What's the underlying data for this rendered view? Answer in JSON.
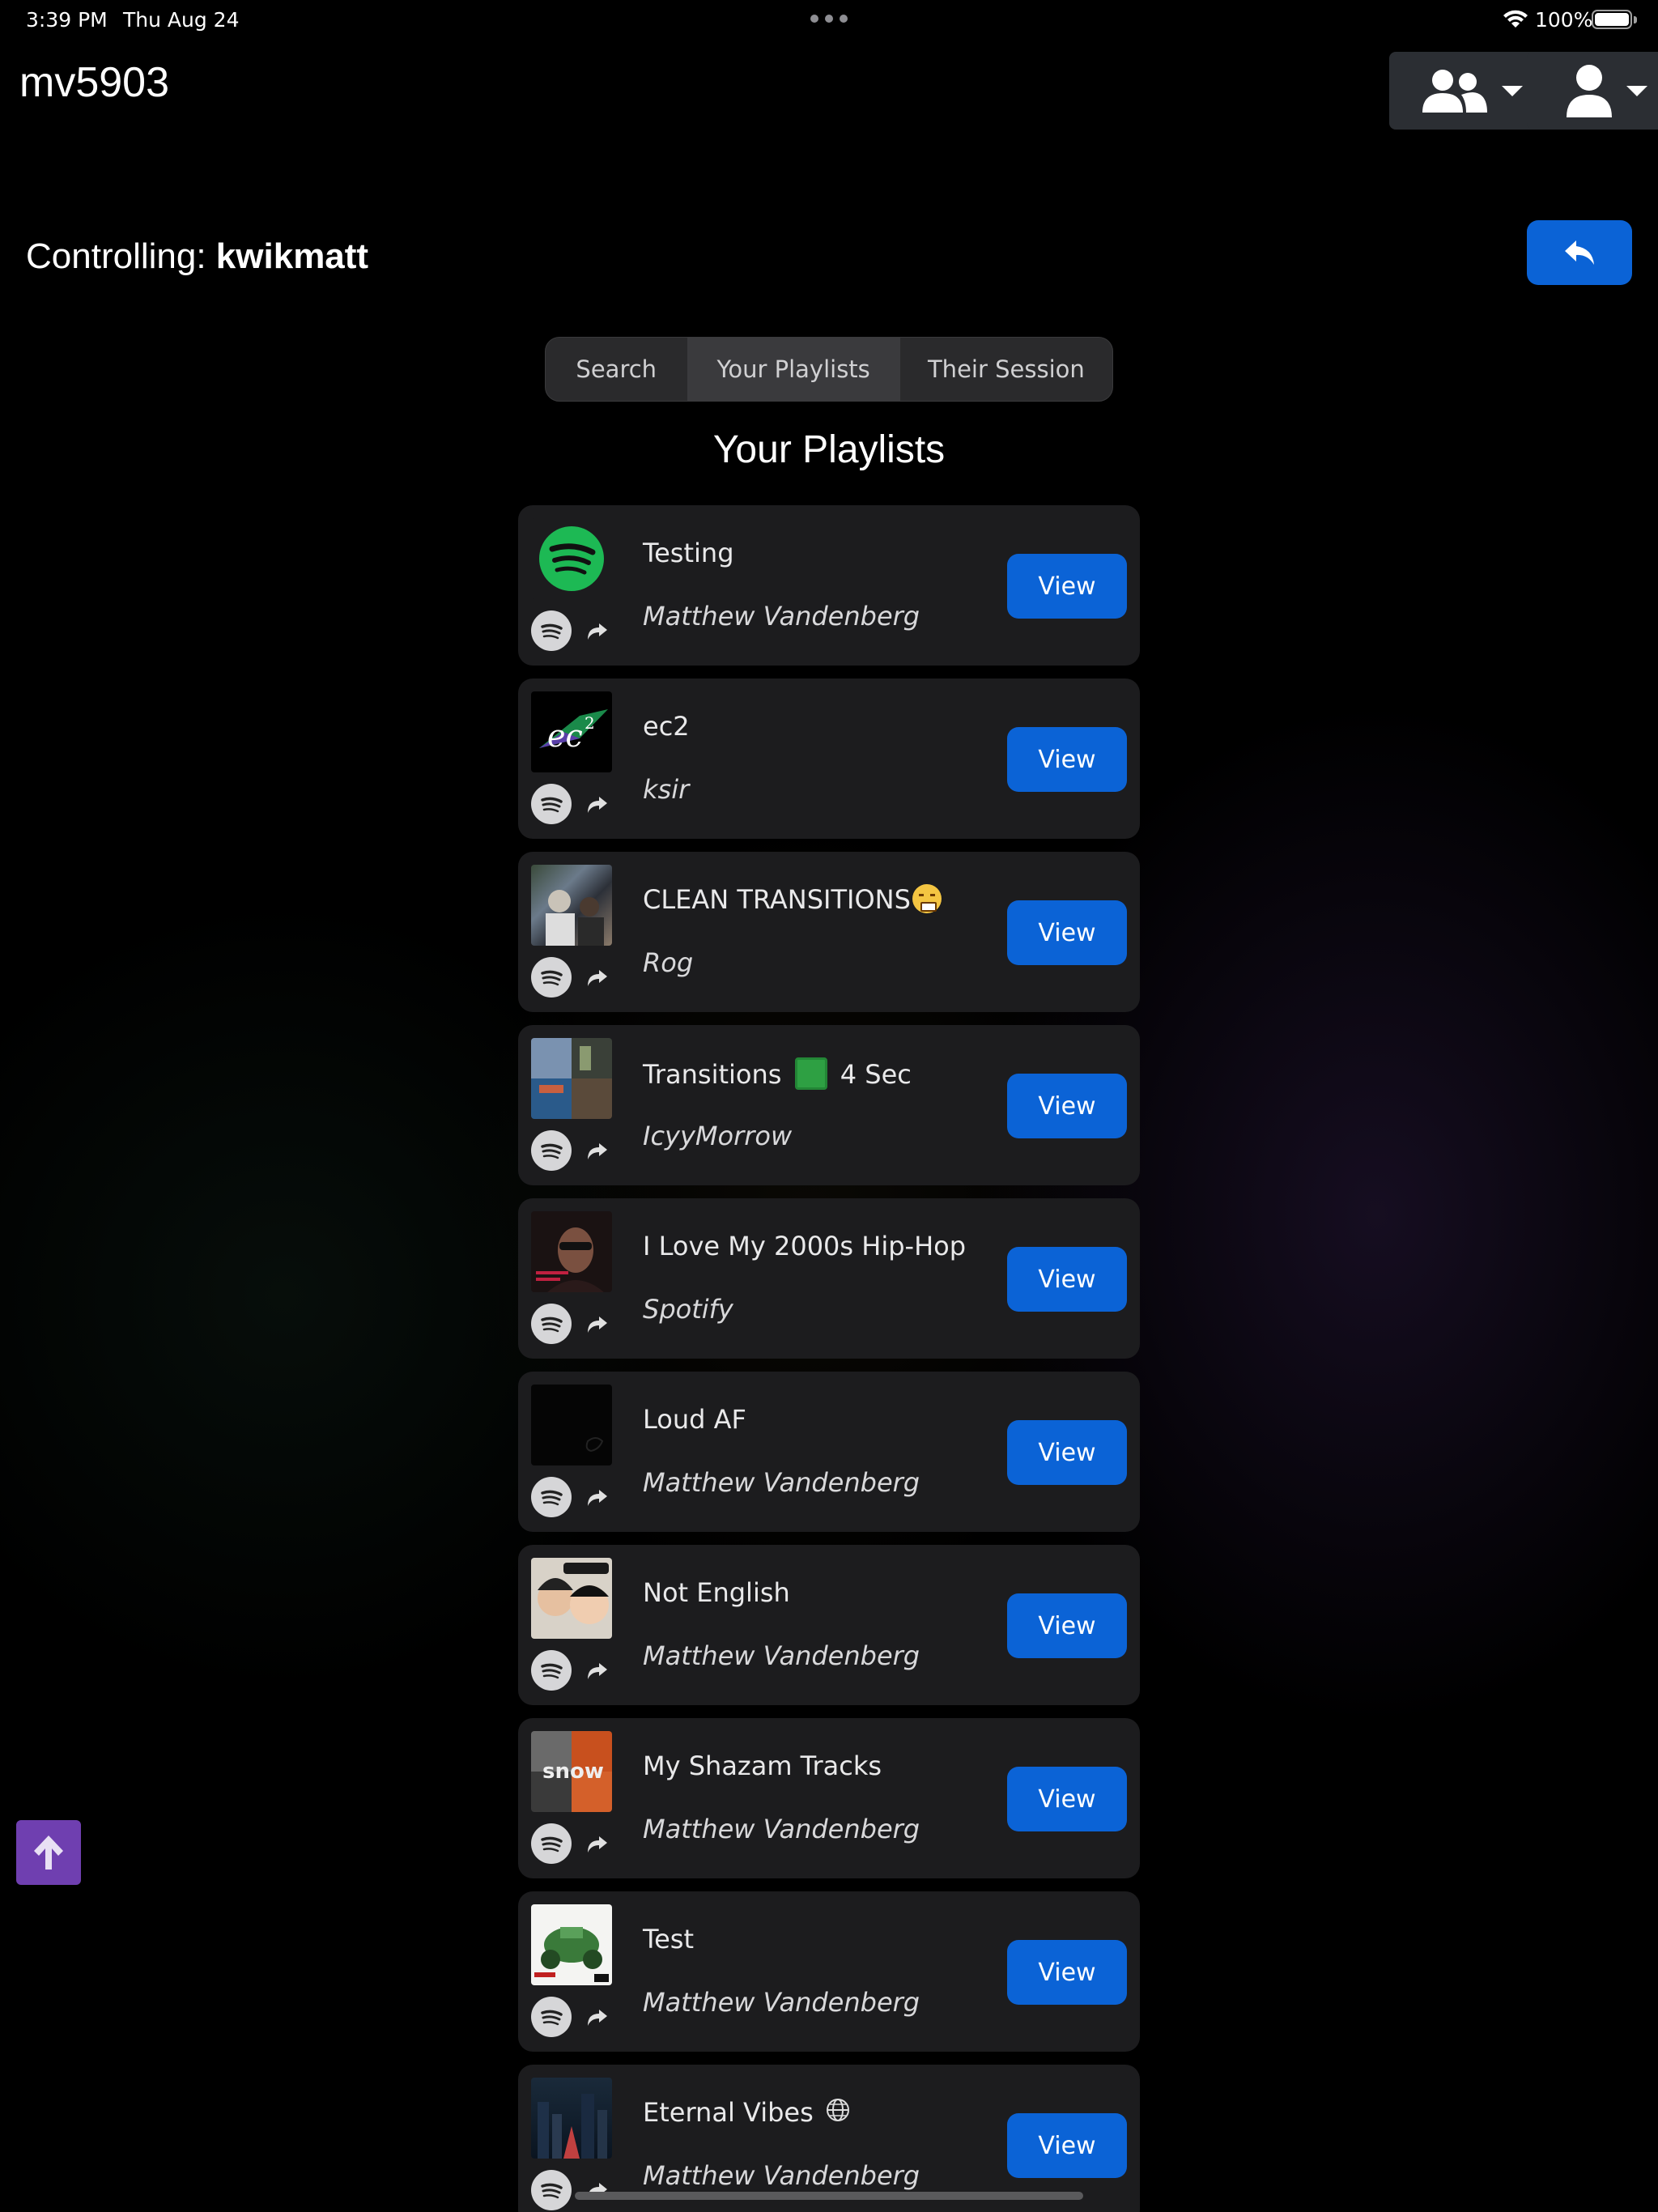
{
  "status_bar": {
    "time": "3:39 PM",
    "date": "Thu Aug 24",
    "battery": "100%"
  },
  "header": {
    "title": "mv5903"
  },
  "controlling": {
    "label": "Controlling:",
    "user": "kwikmatt"
  },
  "tabs": [
    {
      "label": "Search",
      "active": false
    },
    {
      "label": "Your Playlists",
      "active": true
    },
    {
      "label": "Their Session",
      "active": false
    }
  ],
  "section_title": "Your Playlists",
  "view_label": "View",
  "playlists": [
    {
      "name": "Testing",
      "owner": "Matthew Vandenberg",
      "art": "spotify-logo"
    },
    {
      "name": "ec2",
      "owner": "ksir",
      "art": "ec2-logo"
    },
    {
      "name": "CLEAN TRANSITIONS",
      "owner": "Rog",
      "art": "photo-collage",
      "emoji": "face-with-steam-icon"
    },
    {
      "name": "Transitions",
      "name_suffix": "4 Sec",
      "owner": "IcyyMorrow",
      "art": "album-collage",
      "emoji": "green-square-icon"
    },
    {
      "name": "I Love My 2000s Hip-Hop",
      "owner": "Spotify",
      "art": "artist-portrait"
    },
    {
      "name": "Loud AF",
      "owner": "Matthew Vandenberg",
      "art": "black-album"
    },
    {
      "name": "Not English",
      "owner": "Matthew Vandenberg",
      "art": "kids-album"
    },
    {
      "name": "My Shazam Tracks",
      "owner": "Matthew Vandenberg",
      "art": "snow-album"
    },
    {
      "name": "Test",
      "owner": "Matthew Vandenberg",
      "art": "green-car-album"
    },
    {
      "name": "Eternal Vibes",
      "owner": "Matthew Vandenberg",
      "art": "city-night",
      "emoji": "globe-icon"
    }
  ],
  "colors": {
    "accent": "#0b63d6",
    "card": "#1c1c1e",
    "scroll_top": "#6f3fb0",
    "spotify_green": "#1db954"
  }
}
